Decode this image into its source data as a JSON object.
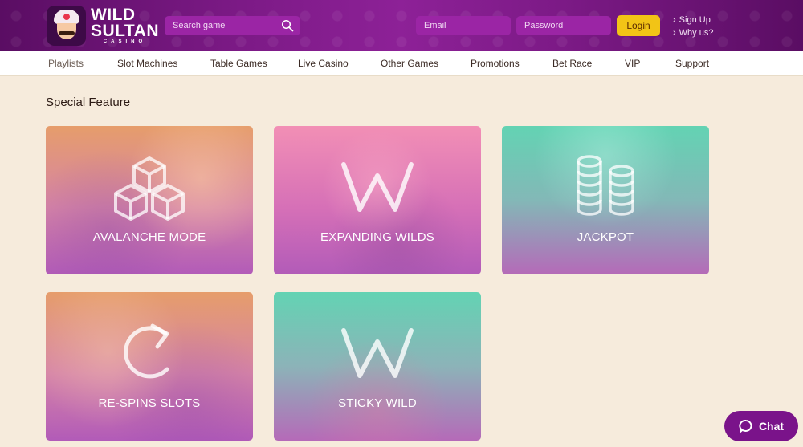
{
  "brand": {
    "line1": "WILD",
    "line2": "SULTAN",
    "line3": "CASINO"
  },
  "search": {
    "placeholder": "Search game",
    "icon": "search-icon"
  },
  "auth": {
    "email_placeholder": "Email",
    "password_placeholder": "Password",
    "login_label": "Login",
    "signup_label": "Sign Up",
    "whyus_label": "Why us?"
  },
  "nav": {
    "items": [
      {
        "label": "Playlists",
        "active": true
      },
      {
        "label": "Slot Machines"
      },
      {
        "label": "Table Games"
      },
      {
        "label": "Live Casino"
      },
      {
        "label": "Other Games"
      },
      {
        "label": "Promotions"
      },
      {
        "label": "Bet Race"
      },
      {
        "label": "VIP"
      },
      {
        "label": "Support"
      }
    ]
  },
  "section": {
    "title": "Special Feature"
  },
  "features": [
    {
      "label": "AVALANCHE MODE",
      "icon": "cubes-icon"
    },
    {
      "label": "EXPANDING WILDS",
      "icon": "w-icon"
    },
    {
      "label": "JACKPOT",
      "icon": "coin-stacks-icon"
    },
    {
      "label": "RE-SPINS SLOTS",
      "icon": "respin-icon"
    },
    {
      "label": "STICKY WILD",
      "icon": "w-icon"
    }
  ],
  "chat": {
    "label": "Chat",
    "icon": "chat-bubble-icon"
  },
  "colors": {
    "header": "#7c1a86",
    "accent": "#f2c416",
    "background": "#f6ebdc",
    "chat": "#7a138a"
  }
}
